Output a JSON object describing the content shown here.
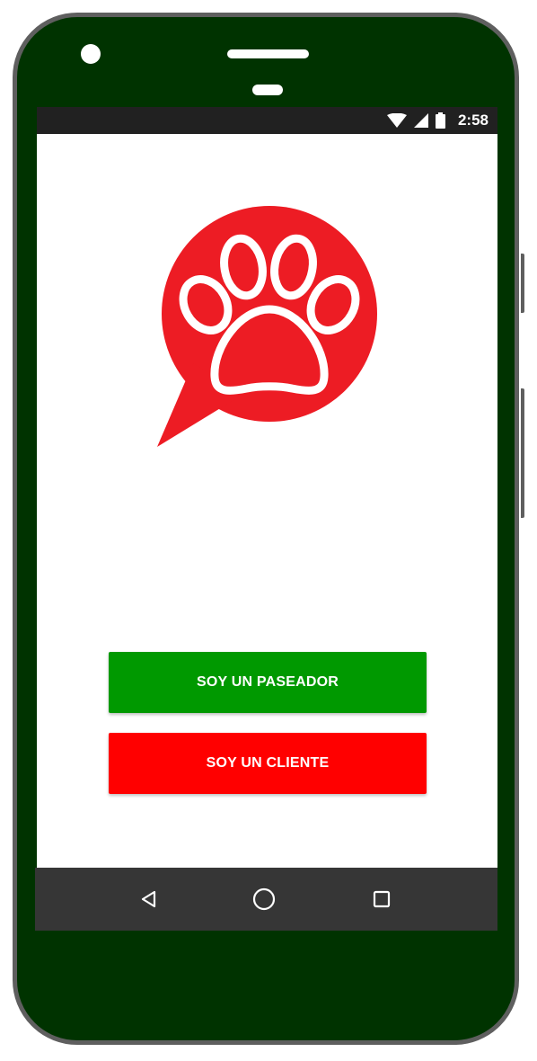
{
  "status_bar": {
    "time": "2:58",
    "icons": [
      "wifi-icon",
      "cell-signal-icon",
      "battery-icon"
    ]
  },
  "logo": {
    "icon": "paw-chat-bubble-icon",
    "color": "#ed1c24"
  },
  "actions": {
    "walker_label": "SOY UN PASEADOR",
    "client_label": "SOY UN CLIENTE"
  },
  "nav_bar": {
    "icons": [
      "back-icon",
      "home-icon",
      "recents-icon"
    ]
  },
  "colors": {
    "device_body": "#003300",
    "walker_button": "#009900",
    "client_button": "#ff0000",
    "status_bar": "#212121",
    "nav_bar": "#363636"
  }
}
